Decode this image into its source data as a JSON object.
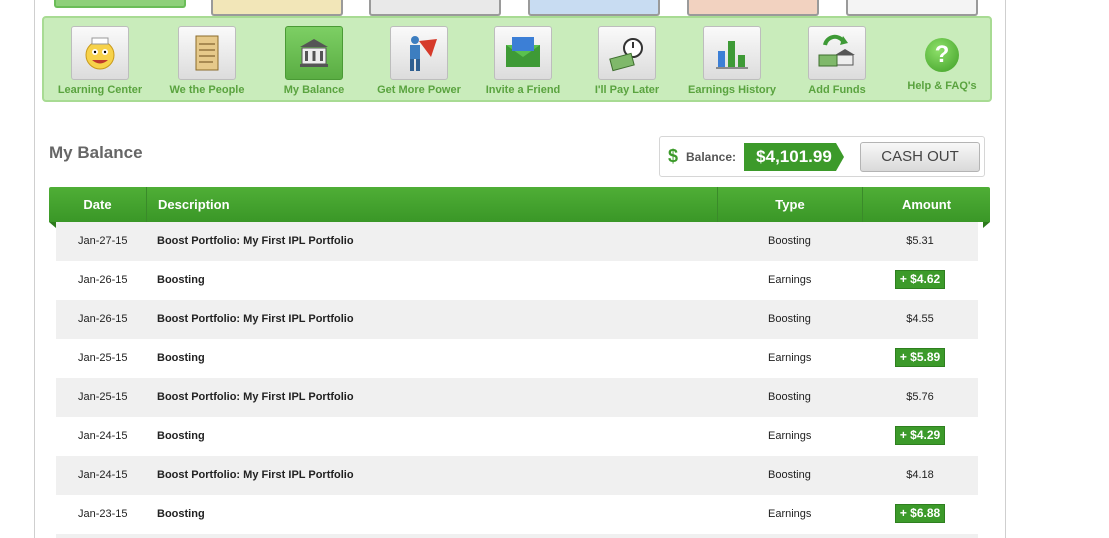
{
  "nav": {
    "items": [
      {
        "label": "Learning Center",
        "icon": "cartoon-face-icon"
      },
      {
        "label": "We the People",
        "icon": "scroll-icon"
      },
      {
        "label": "My Balance",
        "icon": "bank-building-icon"
      },
      {
        "label": "Get More Power",
        "icon": "superhero-icon"
      },
      {
        "label": "Invite a Friend",
        "icon": "envelope-icon"
      },
      {
        "label": "I'll Pay Later",
        "icon": "stopwatch-money-icon"
      },
      {
        "label": "Earnings History",
        "icon": "bar-chart-icon"
      },
      {
        "label": "Add Funds",
        "icon": "money-deposit-icon"
      }
    ],
    "help_label": "Help & FAQ's",
    "help_icon_text": "?"
  },
  "page": {
    "title": "My Balance"
  },
  "balance": {
    "label": "Balance:",
    "value": "$4,101.99",
    "currency_symbol": "$",
    "cash_out_label": "CASH OUT"
  },
  "table": {
    "columns": [
      "Date",
      "Description",
      "Type",
      "Amount"
    ],
    "rows": [
      {
        "date": "Jan-27-15",
        "description": "Boost Portfolio: My First IPL Portfolio",
        "type": "Boosting",
        "amount": "$5.31"
      },
      {
        "date": "Jan-26-15",
        "description": "Boosting",
        "type": "Earnings",
        "amount": "+ $4.62"
      },
      {
        "date": "Jan-26-15",
        "description": "Boost Portfolio: My First IPL Portfolio",
        "type": "Boosting",
        "amount": "$4.55"
      },
      {
        "date": "Jan-25-15",
        "description": "Boosting",
        "type": "Earnings",
        "amount": "+ $5.89"
      },
      {
        "date": "Jan-25-15",
        "description": "Boost Portfolio: My First IPL Portfolio",
        "type": "Boosting",
        "amount": "$5.76"
      },
      {
        "date": "Jan-24-15",
        "description": "Boosting",
        "type": "Earnings",
        "amount": "+ $4.29"
      },
      {
        "date": "Jan-24-15",
        "description": "Boost Portfolio: My First IPL Portfolio",
        "type": "Boosting",
        "amount": "$4.18"
      },
      {
        "date": "Jan-23-15",
        "description": "Boosting",
        "type": "Earnings",
        "amount": "+ $6.88"
      }
    ]
  },
  "colors": {
    "accent_green": "#3c9a2a",
    "nav_panel_bg": "#c9ecbb",
    "nav_label": "#5aa33f"
  }
}
